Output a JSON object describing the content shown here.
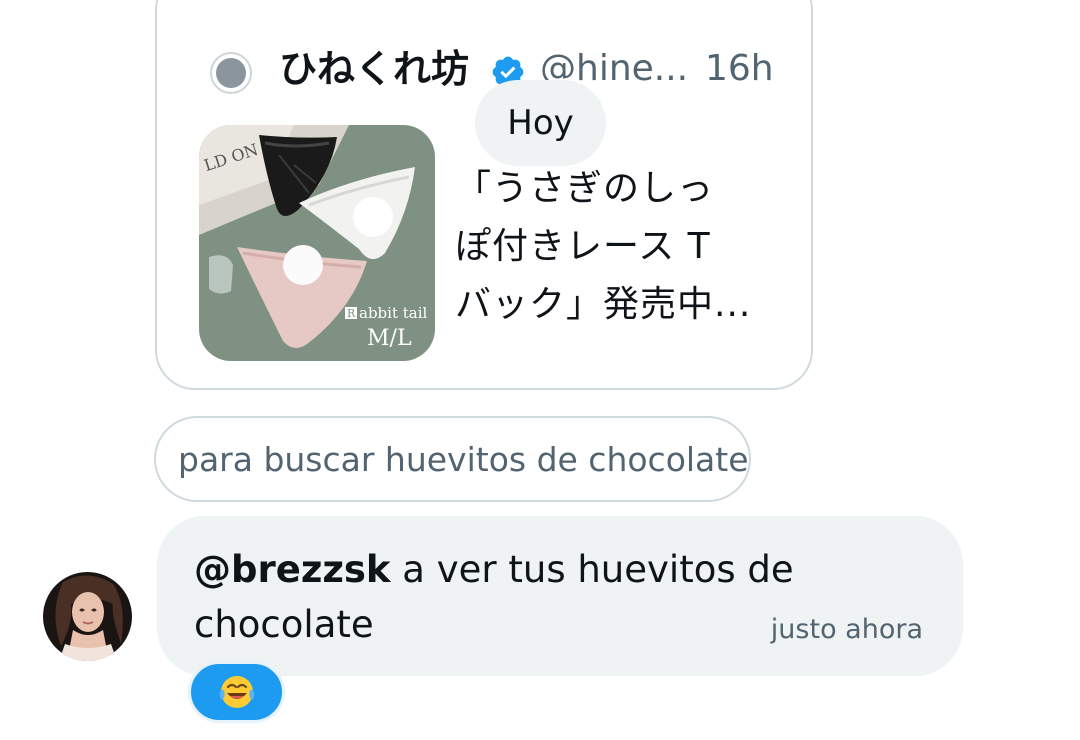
{
  "quoted_tweet": {
    "author_name": "ひねくれ坊",
    "handle": "@hine...",
    "time": "16h",
    "verified": true,
    "text_lines": [
      "「うさぎのしっ",
      "ぽ付きレース T",
      "バック」発売中..."
    ],
    "image_caption": "Rabbit tail",
    "image_sizes": "M/L",
    "image_background_text": "LD ON"
  },
  "date_separator": "Hoy",
  "caption_text": "para buscar huevitos de chocolate",
  "message": {
    "mention": "@brezzsk",
    "text_line1": " a ver tus huevitos de",
    "text_line2": "chocolate",
    "time": "justo ahora"
  },
  "reaction": {
    "emoji_name": "laughing-tears-emoji",
    "count_visible": false
  },
  "colors": {
    "accent": "#1d9bf0",
    "bubble_bg": "#eff3f4",
    "border": "#cfd9de",
    "text_primary": "#0f1419",
    "text_secondary": "#536471"
  }
}
